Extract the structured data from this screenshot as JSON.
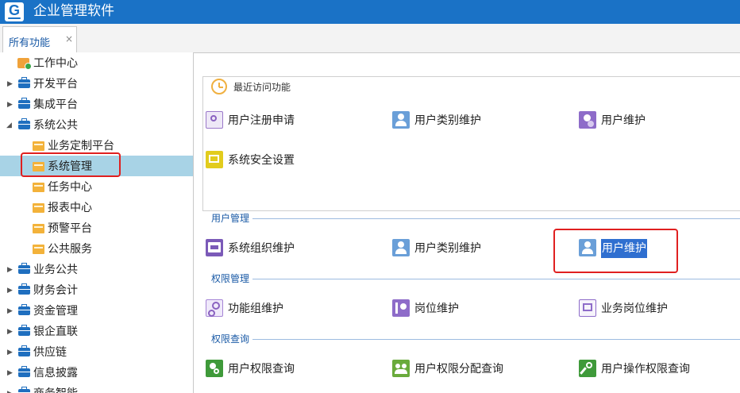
{
  "app": {
    "logo_letter": "G",
    "title": "企业管理软件"
  },
  "tabs": [
    {
      "label": "所有功能",
      "close": "×"
    }
  ],
  "sidebar": {
    "items": [
      {
        "label": "工作中心",
        "level": 0,
        "icon": "workcenter-icon",
        "expander": ""
      },
      {
        "label": "开发平台",
        "level": 0,
        "icon": "briefcase-icon",
        "expander": "collapsed"
      },
      {
        "label": "集成平台",
        "level": 0,
        "icon": "briefcase-icon",
        "expander": "collapsed"
      },
      {
        "label": "系统公共",
        "level": 0,
        "icon": "briefcase-icon",
        "expander": "expanded"
      },
      {
        "label": "业务定制平台",
        "level": 1,
        "icon": "folder-icon",
        "expander": ""
      },
      {
        "label": "系统管理",
        "level": 1,
        "icon": "folder-icon",
        "expander": "",
        "selected": true
      },
      {
        "label": "任务中心",
        "level": 1,
        "icon": "folder-icon",
        "expander": ""
      },
      {
        "label": "报表中心",
        "level": 1,
        "icon": "folder-icon",
        "expander": ""
      },
      {
        "label": "预警平台",
        "level": 1,
        "icon": "folder-icon",
        "expander": ""
      },
      {
        "label": "公共服务",
        "level": 1,
        "icon": "folder-icon",
        "expander": ""
      },
      {
        "label": "业务公共",
        "level": 0,
        "icon": "briefcase-icon",
        "expander": "collapsed"
      },
      {
        "label": "财务会计",
        "level": 0,
        "icon": "briefcase-icon",
        "expander": "collapsed"
      },
      {
        "label": "资金管理",
        "level": 0,
        "icon": "briefcase-icon",
        "expander": "collapsed"
      },
      {
        "label": "银企直联",
        "level": 0,
        "icon": "briefcase-icon",
        "expander": "collapsed"
      },
      {
        "label": "供应链",
        "level": 0,
        "icon": "briefcase-icon",
        "expander": "collapsed"
      },
      {
        "label": "信息披露",
        "level": 0,
        "icon": "briefcase-icon",
        "expander": "collapsed"
      },
      {
        "label": "商务智能",
        "level": 0,
        "icon": "briefcase-icon",
        "expander": "collapsed"
      }
    ]
  },
  "recent": {
    "title": "最近访问功能",
    "items": [
      {
        "label": "用户注册申请",
        "icon": "user-register-icon"
      },
      {
        "label": "用户类别维护",
        "icon": "user-category-icon"
      },
      {
        "label": "用户维护",
        "icon": "user-maintain-icon"
      },
      {
        "label": "系统安全设置",
        "icon": "security-settings-icon"
      }
    ]
  },
  "sections": [
    {
      "title": "用户管理",
      "items": [
        {
          "label": "系统组织维护",
          "icon": "org-maintain-icon"
        },
        {
          "label": "用户类别维护",
          "icon": "user-category-icon"
        },
        {
          "label": "用户维护",
          "icon": "user-maintain-icon",
          "highlighted": true
        }
      ]
    },
    {
      "title": "权限管理",
      "items": [
        {
          "label": "功能组维护",
          "icon": "function-group-icon"
        },
        {
          "label": "岗位维护",
          "icon": "post-maintain-icon"
        },
        {
          "label": "业务岗位维护",
          "icon": "business-post-icon"
        }
      ]
    },
    {
      "title": "权限查询",
      "items": [
        {
          "label": "用户权限查询",
          "icon": "user-permission-query-icon"
        },
        {
          "label": "用户权限分配查询",
          "icon": "permission-assign-query-icon"
        },
        {
          "label": "用户操作权限查询",
          "icon": "operation-permission-query-icon"
        }
      ]
    }
  ],
  "colors": {
    "titlebar": "#1a72c6",
    "selection": "#a8d3e6",
    "highlight": "#2f6fd0",
    "callout": "#e02020"
  }
}
